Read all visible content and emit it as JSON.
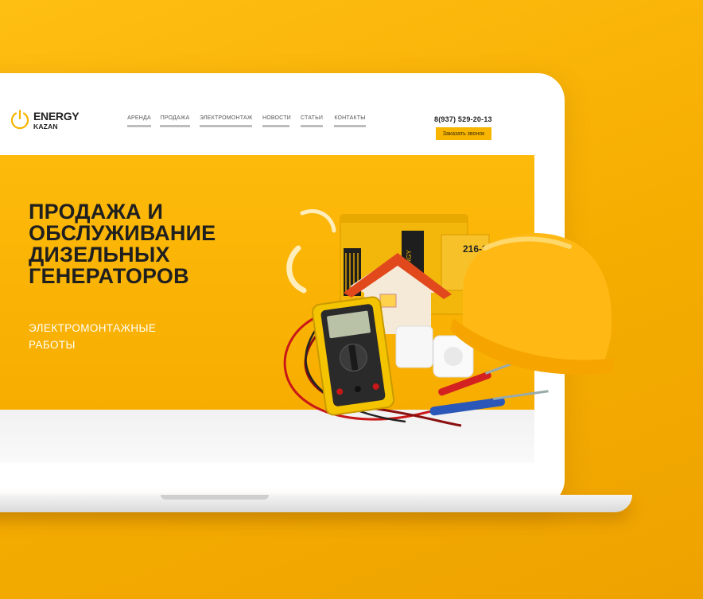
{
  "header": {
    "logo": {
      "name": "ENERGY",
      "sub": "KAZAN"
    },
    "nav": [
      {
        "label": "АРЕНДА"
      },
      {
        "label": "ПРОДАЖА"
      },
      {
        "label": "ЭЛЕКТРОМОНТАЖ"
      },
      {
        "label": "НОВОСТИ"
      },
      {
        "label": "СТАТЬИ"
      },
      {
        "label": "КОНТАКТЫ"
      }
    ],
    "phone": "8(937) 529-20-13",
    "call_button": "Заказать звонок"
  },
  "hero": {
    "title": "ПРОДАЖА И\nОБСЛУЖИВАНИЕ\nДИЗЕЛЬНЫХ\nГЕНЕРАТОРОВ",
    "subtitle": "ЭЛЕКТРОМОНТАЖНЫЕ\nРАБОТЫ",
    "generator_phone": "216-39-88",
    "generator_brand": "ENERGY"
  },
  "colors": {
    "brand_yellow": "#f7b500",
    "text_dark": "#1f1f1f",
    "nav_underline": "#bdbdbd"
  },
  "icons": [
    "power-icon",
    "hard-hat-icon",
    "multimeter-icon",
    "house-icon",
    "generator-icon",
    "screwdriver-icon"
  ]
}
